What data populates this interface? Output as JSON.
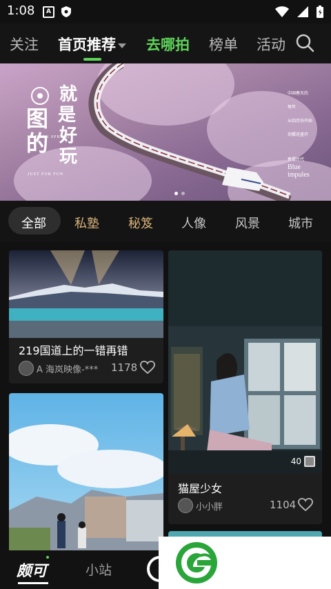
{
  "status": {
    "time": "1:08",
    "icons": [
      "a-notification-icon",
      "shield-icon",
      "wifi-icon",
      "signal-icon",
      "battery-icon"
    ]
  },
  "nav": {
    "tabs": [
      {
        "label": "关注",
        "state": "normal"
      },
      {
        "label": "首页推荐",
        "state": "active"
      },
      {
        "label": "去哪拍",
        "state": "highlight"
      },
      {
        "label": "榜单",
        "state": "normal"
      },
      {
        "label": "活动",
        "state": "normal"
      }
    ],
    "accent_color": "#5fd35a"
  },
  "banner": {
    "title_lines": [
      "就",
      "是",
      "好",
      "玩"
    ],
    "title_left": [
      "图",
      "的"
    ],
    "subtitle": "JUST FOR FUN",
    "small_caption": "HAOKEN SPRING",
    "right_texts": [
      "中国春天的",
      "每年",
      "从四月份开始",
      "到樱花盛开",
      "春樱时代"
    ],
    "blue_text": [
      "Blue",
      "impules"
    ],
    "page_count": 2,
    "active_page": 1
  },
  "categories": [
    {
      "label": "全部",
      "state": "active"
    },
    {
      "label": "私塾",
      "state": "gold"
    },
    {
      "label": "秘笈",
      "state": "gold"
    },
    {
      "label": "人像",
      "state": "normal"
    },
    {
      "label": "风景",
      "state": "normal"
    },
    {
      "label": "城市",
      "state": "normal"
    }
  ],
  "cards": [
    {
      "title": "219国道上的一错再错",
      "author": "A 海岚映像-***",
      "likes": "1178"
    },
    {
      "title": "猫屋少女",
      "author": "小小胖",
      "likes": "1104",
      "photos": "40"
    }
  ],
  "bottom_nav": {
    "items": [
      {
        "label": "颇可",
        "state": "active"
      },
      {
        "label": "小站",
        "state": "normal"
      }
    ]
  }
}
